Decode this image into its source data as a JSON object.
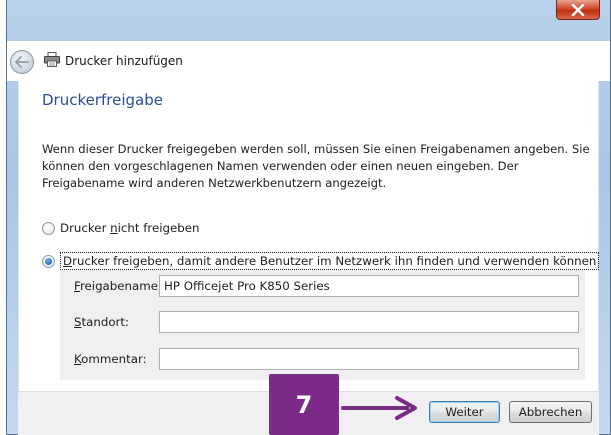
{
  "window": {
    "title": "Drucker hinzufügen",
    "close_label": "Schließen"
  },
  "page": {
    "heading": "Druckerfreigabe",
    "description": "Wenn dieser Drucker freigegeben werden soll, müssen Sie einen Freigabenamen angeben. Sie können den vorgeschlagenen Namen verwenden oder einen neuen eingeben. Der Freigabename wird anderen Netzwerkbenutzern angezeigt."
  },
  "options": {
    "no_share": {
      "pre": "Drucker ",
      "accel": "n",
      "post": "icht freigeben",
      "selected": false
    },
    "share": {
      "pre": "",
      "accel": "D",
      "post": "rucker freigeben, damit andere Benutzer im Netzwerk ihn finden und verwenden können",
      "selected": true
    }
  },
  "fields": {
    "share_name": {
      "accel": "F",
      "rest": "reigabename:",
      "value": "HP Officejet Pro K850 Series"
    },
    "location": {
      "accel": "S",
      "rest": "tandort:",
      "value": ""
    },
    "comment": {
      "accel": "K",
      "rest": "ommentar:",
      "value": ""
    }
  },
  "footer": {
    "next_label": "Weiter",
    "cancel_label": "Abbrechen"
  },
  "annotation": {
    "step_number": "7",
    "badge_color": "#7a2b86"
  }
}
